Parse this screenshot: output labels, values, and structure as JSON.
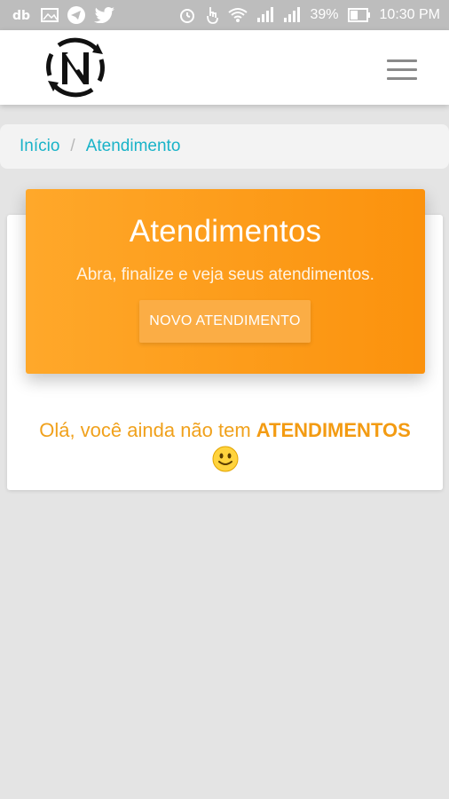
{
  "status_bar": {
    "battery_percent": "39%",
    "time": "10:30 PM",
    "left_icons": [
      "dropbox-icon",
      "gallery-icon",
      "telegram-icon",
      "twitter-icon"
    ],
    "right_icons": [
      "alarm-icon",
      "touch-icon",
      "wifi-icon",
      "signal-icon",
      "signal-r-icon",
      "battery-icon"
    ]
  },
  "header": {
    "logo_icon": "brand-logo-icon",
    "menu_icon": "hamburger-menu-icon"
  },
  "breadcrumb": {
    "items": [
      "Início",
      "Atendimento"
    ],
    "separator": "/"
  },
  "hero": {
    "title": "Atendimentos",
    "subtitle": "Abra, finalize e veja seus atendimentos.",
    "button_label": "NOVO ATENDIMENTO"
  },
  "empty_state": {
    "message_prefix": "Olá, você ainda não tem ",
    "message_emphasis": "ATENDIMENTOS",
    "emoji_icon": "smiley-icon"
  },
  "colors": {
    "accent_orange": "#fb9a1c",
    "breadcrumb_link": "#19b3c8",
    "empty_text": "#f0a11c"
  }
}
